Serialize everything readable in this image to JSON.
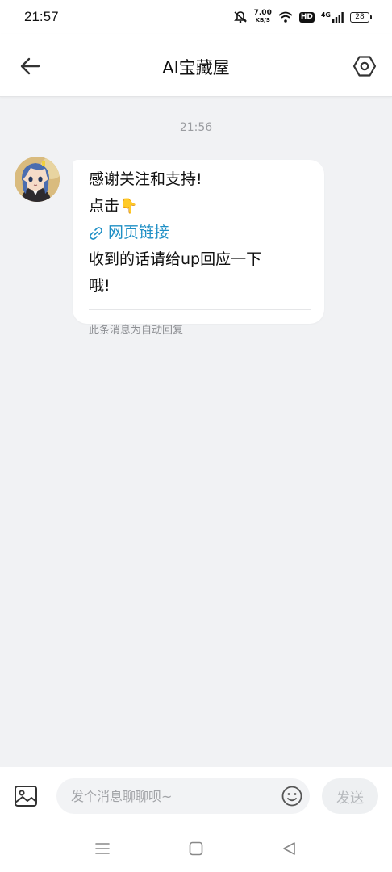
{
  "status_bar": {
    "time": "21:57",
    "net_speed_value": "7.00",
    "net_speed_unit": "KB/S",
    "hd_label": "HD",
    "network_label": "4G",
    "battery_level": "28"
  },
  "header": {
    "title": "AI宝藏屋",
    "back_icon": "arrow-left-icon",
    "settings_icon": "hexagon-gear-icon"
  },
  "chat": {
    "timestamp": "21:56",
    "message": {
      "line1": "感谢关注和支持!",
      "line2": "点击",
      "line2_emoji": "👇",
      "link_icon": "link-icon",
      "link_text": "网页链接",
      "line4": "收到的话请给up回应一下",
      "line5": "哦!",
      "auto_reply_note": "此条消息为自动回复"
    }
  },
  "input_bar": {
    "placeholder": "发个消息聊聊呗~",
    "send_label": "发送",
    "image_icon": "image-icon",
    "emoji_icon": "smiley-icon"
  },
  "nav_bar": {
    "menu_icon": "menu-icon",
    "home_icon": "square-icon",
    "back_icon": "triangle-back-icon"
  },
  "colors": {
    "link": "#1e8fc5",
    "background": "#f1f2f4",
    "bubble": "#ffffff"
  }
}
